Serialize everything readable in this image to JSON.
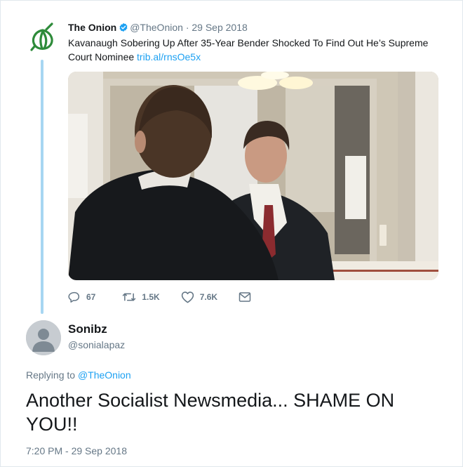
{
  "parent_tweet": {
    "author_name": "The Onion",
    "handle": "@TheOnion",
    "separator": "·",
    "date": "29 Sep 2018",
    "text": "Kavanaugh Sobering Up After 35-Year Bender Shocked To Find Out He’s Supreme Court Nominee ",
    "link": "trib.al/rnsOe5x",
    "avatar_icon": "onion-logo-icon",
    "verified_icon": "verified-badge-icon",
    "brand_color": "#1da1f2",
    "logo_color": "#2e8b3a",
    "actions": {
      "replies": "67",
      "retweets": "1.5K",
      "likes": "7.6K"
    }
  },
  "reply_tweet": {
    "author_name": "Sonibz",
    "handle": "@sonialapaz",
    "replying_prefix": "Replying to ",
    "replying_to": "@TheOnion",
    "text": "Another Socialist Newsmedia... SHAME ON YOU!!",
    "timestamp": "7:20 PM - 29 Sep 2018",
    "avatar_icon": "default-avatar-icon"
  }
}
